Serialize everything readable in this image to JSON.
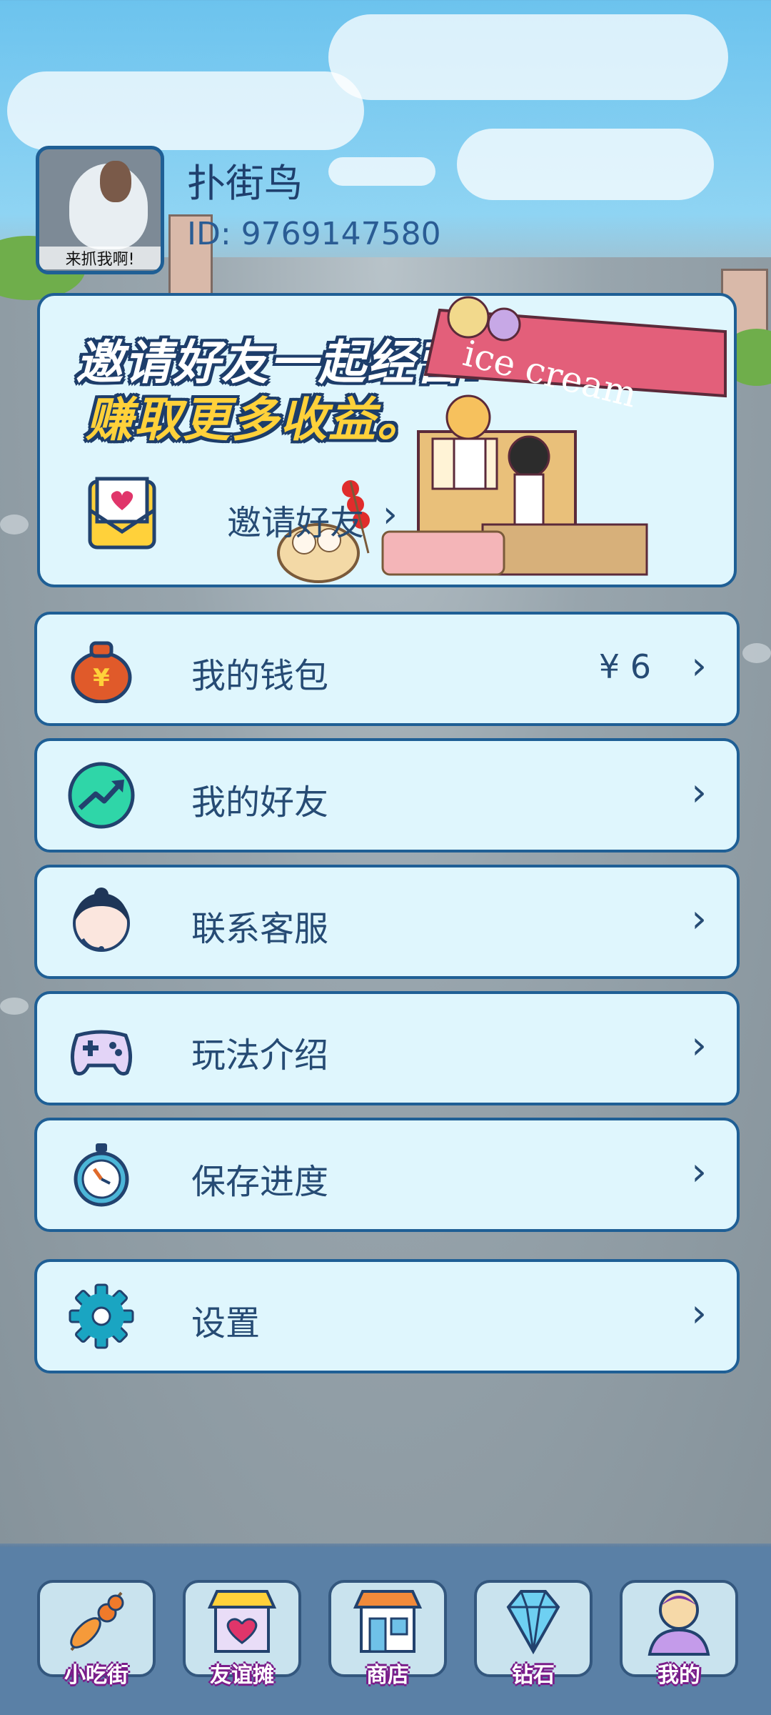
{
  "profile": {
    "avatar_caption": "来抓我啊!",
    "username": "扑街鸟",
    "id": "ID: 9769147580"
  },
  "invite_card": {
    "headline": "邀请好友一起经营!",
    "subheadline": "赚取更多收益。",
    "button_label": "邀请好友",
    "artwork_text": "ice cream"
  },
  "menu": {
    "wallet": {
      "label": "我的钱包",
      "value": "¥ 6"
    },
    "friends": {
      "label": "我的好友"
    },
    "support": {
      "label": "联系客服"
    },
    "guide": {
      "label": "玩法介绍"
    },
    "save": {
      "label": "保存进度"
    },
    "settings": {
      "label": "设置"
    }
  },
  "chevron": "›",
  "tabs": [
    {
      "label": "小吃街",
      "icon": "skewer-icon"
    },
    {
      "label": "友谊摊",
      "icon": "heart-stall-icon"
    },
    {
      "label": "商店",
      "icon": "shop-icon"
    },
    {
      "label": "钻石",
      "icon": "diamond-icon"
    },
    {
      "label": "我的",
      "icon": "user-icon"
    }
  ],
  "colors": {
    "card_bg": "#dff6fd",
    "card_border": "#1f5f95",
    "text": "#264b74",
    "tabbar": "#5a80a6",
    "accent_yellow": "#ffd13a"
  }
}
